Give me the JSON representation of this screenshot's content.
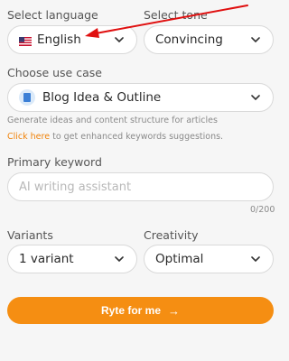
{
  "language": {
    "label": "Select language",
    "value": "English",
    "flag_icon": "us-flag-icon"
  },
  "tone": {
    "label": "Select tone",
    "value": "Convincing"
  },
  "use_case": {
    "label": "Choose use case",
    "value": "Blog Idea & Outline",
    "description": "Generate ideas and content structure for articles",
    "hint_link": "Click here",
    "hint_rest": " to get enhanced keywords suggestions."
  },
  "keyword": {
    "label": "Primary keyword",
    "placeholder": "AI writing assistant",
    "counter": "0/200"
  },
  "variants": {
    "label": "Variants",
    "value": "1 variant"
  },
  "creativity": {
    "label": "Creativity",
    "value": "Optimal"
  },
  "cta": {
    "label": "Ryte for me",
    "arrow": "→"
  },
  "colors": {
    "accent": "#f58e12",
    "link": "#f0830b",
    "annotation": "#e01010"
  }
}
